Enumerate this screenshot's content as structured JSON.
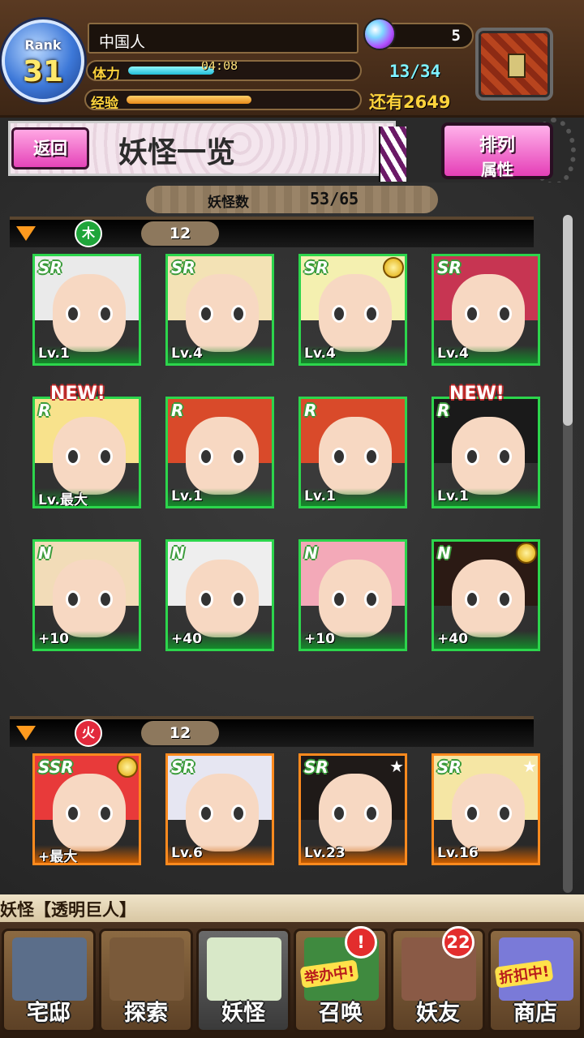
{
  "status": {
    "rank_label": "Rank",
    "rank_value": "31",
    "player_name": "中国人",
    "stamina_label": "体力",
    "stamina_timer": "04:08",
    "stamina_value": "13/34",
    "stamina_fill": 0.38,
    "exp_label": "经验",
    "exp_remaining": "还有2649",
    "exp_fill": 0.55,
    "gems": "5"
  },
  "header": {
    "back_label": "返回",
    "title": "妖怪一览",
    "sort_line1": "排列",
    "sort_line2": "属性"
  },
  "summary": {
    "count_label": "妖怪数",
    "count_value": "53/65"
  },
  "sections": [
    {
      "element": "木",
      "element_color": "#1fa53a",
      "count": "12",
      "cards": [
        {
          "rarity": "SR",
          "level": "Lv.1",
          "hair": "#eaeaea"
        },
        {
          "rarity": "SR",
          "level": "Lv.4",
          "hair": "#f3e2b5"
        },
        {
          "rarity": "SR",
          "level": "Lv.4",
          "hair": "#f4f0b0",
          "medal": true
        },
        {
          "rarity": "SR",
          "level": "Lv.4",
          "hair": "#c73552"
        },
        {
          "rarity": "R",
          "level": "Lv.最大",
          "hair": "#f8e28c",
          "new": "NEW!"
        },
        {
          "rarity": "R",
          "level": "Lv.1",
          "hair": "#d94a2a"
        },
        {
          "rarity": "R",
          "level": "Lv.1",
          "hair": "#d94a2a"
        },
        {
          "rarity": "R",
          "level": "Lv.1",
          "hair": "#1a1a1a",
          "new": "NEW!"
        },
        {
          "rarity": "N",
          "level": "+10",
          "hair": "#f2dcb8"
        },
        {
          "rarity": "N",
          "level": "+40",
          "hair": "#eeeeee"
        },
        {
          "rarity": "N",
          "level": "+10",
          "hair": "#f3a9b8"
        },
        {
          "rarity": "N",
          "level": "+40",
          "hair": "#2b1a14",
          "medal": true
        }
      ]
    },
    {
      "element": "火",
      "element_color": "#e2293c",
      "count": "12",
      "cards": [
        {
          "rarity": "SSR",
          "level": "+最大",
          "hair": "#e83a3a",
          "medal": true
        },
        {
          "rarity": "SR",
          "level": "Lv.6",
          "hair": "#e6e6f2"
        },
        {
          "rarity": "SR",
          "level": "Lv.23",
          "hair": "#1f1a18",
          "star": true
        },
        {
          "rarity": "SR",
          "level": "Lv.16",
          "hair": "#f5e6a4",
          "star": true
        }
      ]
    }
  ],
  "ticker": "妖怪【透明巨人】",
  "nav": [
    {
      "label": "宅邸",
      "color": "#5b6e8a"
    },
    {
      "label": "探索",
      "color": "#7a5a3a"
    },
    {
      "label": "妖怪",
      "color": "#d8e8c8",
      "active": true
    },
    {
      "label": "召唤",
      "color": "#3f8a3f",
      "badge": "!",
      "promo": "举办中!"
    },
    {
      "label": "妖友",
      "color": "#8a5a46",
      "badge": "22"
    },
    {
      "label": "商店",
      "color": "#7a7ad8",
      "promo": "折扣中!"
    }
  ]
}
